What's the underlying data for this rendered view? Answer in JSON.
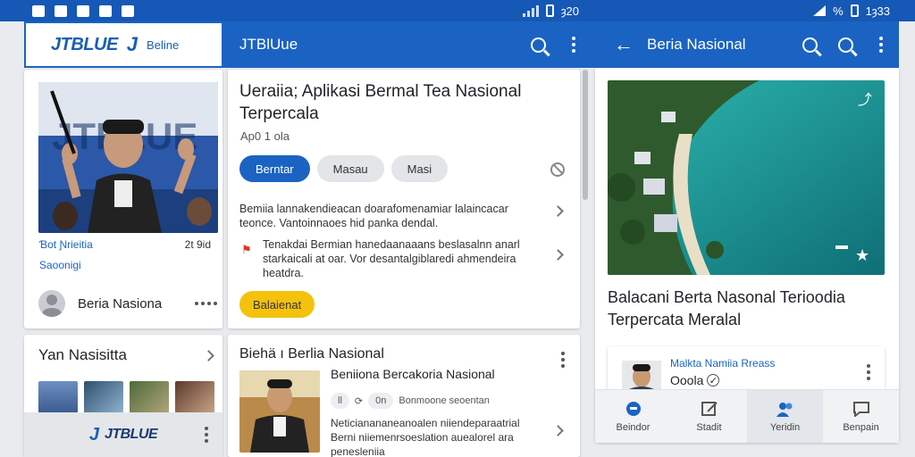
{
  "statusbar": {
    "mid_time": "ȝ20",
    "right_pct": "%",
    "right_time": "1ȝ33"
  },
  "left_panel": {
    "brand": "JTBLUE",
    "brand_sub": "Beline",
    "hero_tag": "Ɓot Ɲrieitia",
    "hero_time": "2t 9id",
    "hero_subtag": "Saoonigi",
    "author": "Beria Nasiona",
    "section_title": "Yan  Nasisitta",
    "bottom_brand": "JTBLUE"
  },
  "middle_panel": {
    "appbar_title": "JTBlUue",
    "article_title": "Ueraiia; Aplikasi Bermal Tea Nasional Terpercala",
    "article_meta": "Ap0 1 ola",
    "chips": [
      "Berntar",
      "Masau",
      "Masi"
    ],
    "para1": "Bemiia lannakendieacan doarafomenamiar lalaincacar teonce. Vantoinnaoes hid panka dendal.",
    "para2": "Tenakdai Bermian hanedaanaaans beslasalnn anarl starkaicali at oar. Vor desantalgiblaredi ahmendeira heatdra.",
    "cta": "Balaienat",
    "news_head": "Biehä ı Berlia Nasional",
    "news_sub": "Beniiona Bercakoria Nasional",
    "news_meta": [
      "Ɩl",
      "0n",
      "Bonmoone seoentan"
    ],
    "news_body": "Neticianananeanoalen niiendeparaatrial Berni niiemenrsoeslation auealorel ara penesleniia"
  },
  "right_panel": {
    "appbar_title": "Beria Nasional",
    "big_title": "Balacani Berta Nasonal Terioodia Terpercata Meralal",
    "mini_source": "Malkta Namiia Rreass",
    "mini_name": "Ooola",
    "nav": [
      "Beindor",
      "Stadit",
      "Yeridin",
      "Benpain"
    ]
  },
  "colors": {
    "accent": "#1a63c3",
    "statusbar": "#1558b5",
    "cta_yellow": "#f4c20d"
  }
}
